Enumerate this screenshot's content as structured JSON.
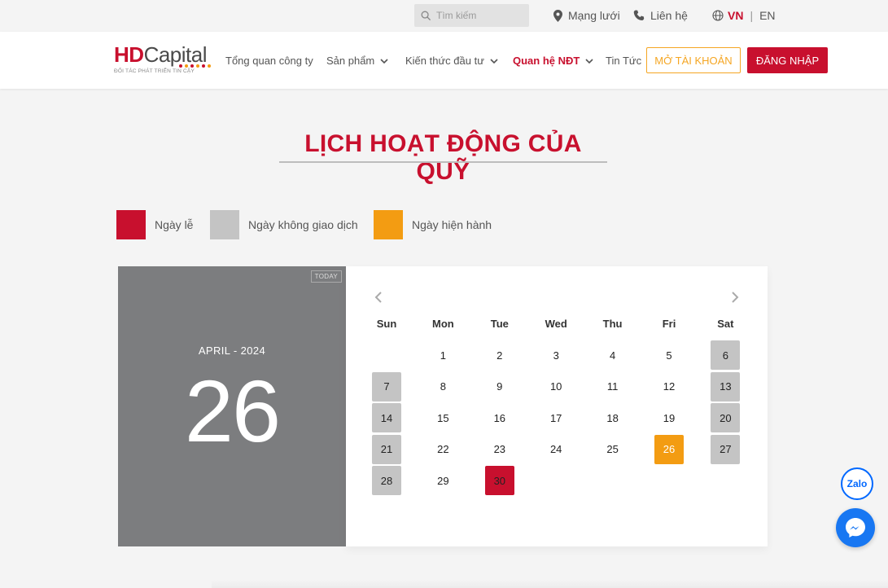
{
  "topbar": {
    "search_placeholder": "Tìm kiếm",
    "network_label": "Mạng lưới",
    "contact_label": "Liên hệ",
    "lang_vn": "VN",
    "lang_sep": "|",
    "lang_en": "EN"
  },
  "header": {
    "logo_hd": "HD",
    "logo_capital": "Capital",
    "logo_tagline": "ĐỐI TÁC PHÁT TRIỂN TIN CẬY",
    "nav": [
      {
        "label": "Tổng quan công ty"
      },
      {
        "label": "Sản phẩm"
      },
      {
        "label": "Kiến thức đầu tư"
      },
      {
        "label": "Quan hệ NĐT"
      },
      {
        "label": "Tin Tức"
      }
    ],
    "open_account": "MỞ TÀI KHOẢN",
    "login": "ĐĂNG NHẬP"
  },
  "page": {
    "title": "LỊCH HOẠT ĐỘNG CỦA QUỸ"
  },
  "legend": [
    {
      "label": "Ngày lễ",
      "color": "#c8102e"
    },
    {
      "label": "Ngày không giao dịch",
      "color": "#c4c4c4"
    },
    {
      "label": "Ngày hiện hành",
      "color": "#f39c12"
    }
  ],
  "calendar": {
    "today_tag": "TODAY",
    "month_year": "APRIL - 2024",
    "selected_day": "26",
    "weekdays": [
      "Sun",
      "Mon",
      "Tue",
      "Wed",
      "Thu",
      "Fri",
      "Sat"
    ],
    "first_weekday": 1,
    "days_in_month": 30,
    "non_trading_days": [
      6,
      7,
      13,
      14,
      20,
      21,
      27,
      28
    ],
    "holidays": [
      30
    ],
    "current_day": 26
  },
  "floating": {
    "zalo_label": "Zalo"
  },
  "colors": {
    "brand_red": "#c8102e",
    "accent_orange": "#f39c12",
    "off_gray": "#c4c4c4"
  }
}
